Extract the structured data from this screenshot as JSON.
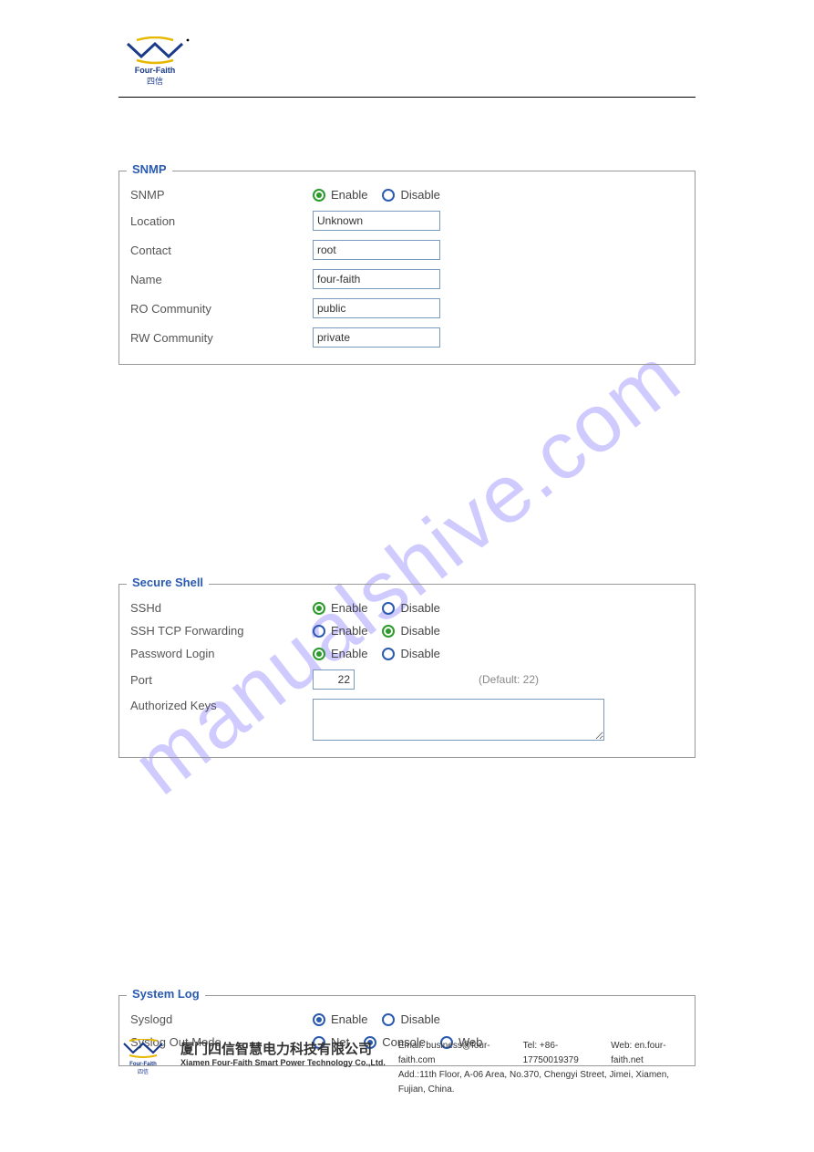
{
  "logo_brand": "Four-Faith",
  "logo_sub": "四信",
  "watermark": "manualshive.com",
  "snmp": {
    "legend": "SNMP",
    "rows": {
      "snmp_label": "SNMP",
      "enable": "Enable",
      "disable": "Disable",
      "location_label": "Location",
      "location_value": "Unknown",
      "contact_label": "Contact",
      "contact_value": "root",
      "name_label": "Name",
      "name_value": "four-faith",
      "ro_label": "RO Community",
      "ro_value": "public",
      "rw_label": "RW Community",
      "rw_value": "private"
    }
  },
  "ssh": {
    "legend": "Secure Shell",
    "rows": {
      "sshd_label": "SSHd",
      "enable": "Enable",
      "disable": "Disable",
      "tcp_label": "SSH TCP Forwarding",
      "pwd_label": "Password Login",
      "port_label": "Port",
      "port_value": "22",
      "port_hint": "(Default: 22)",
      "keys_label": "Authorized Keys"
    }
  },
  "syslog": {
    "legend": "System Log",
    "rows": {
      "syslogd_label": "Syslogd",
      "enable": "Enable",
      "disable": "Disable",
      "mode_label": "Syslog Out Mode",
      "net": "Net",
      "console": "Console",
      "web": "Web"
    }
  },
  "footer": {
    "company_cn": "厦门四信智慧电力科技有限公司",
    "company_en": "Xiamen Four-Faith Smart Power Technology Co.,Ltd.",
    "email": "Email: business@four-faith.com",
    "tel": "Tel: +86-17750019379",
    "web": "Web: en.four-faith.net",
    "addr": "Add.:11th Floor, A-06 Area, No.370, Chengyi Street, Jimei, Xiamen, Fujian, China."
  }
}
